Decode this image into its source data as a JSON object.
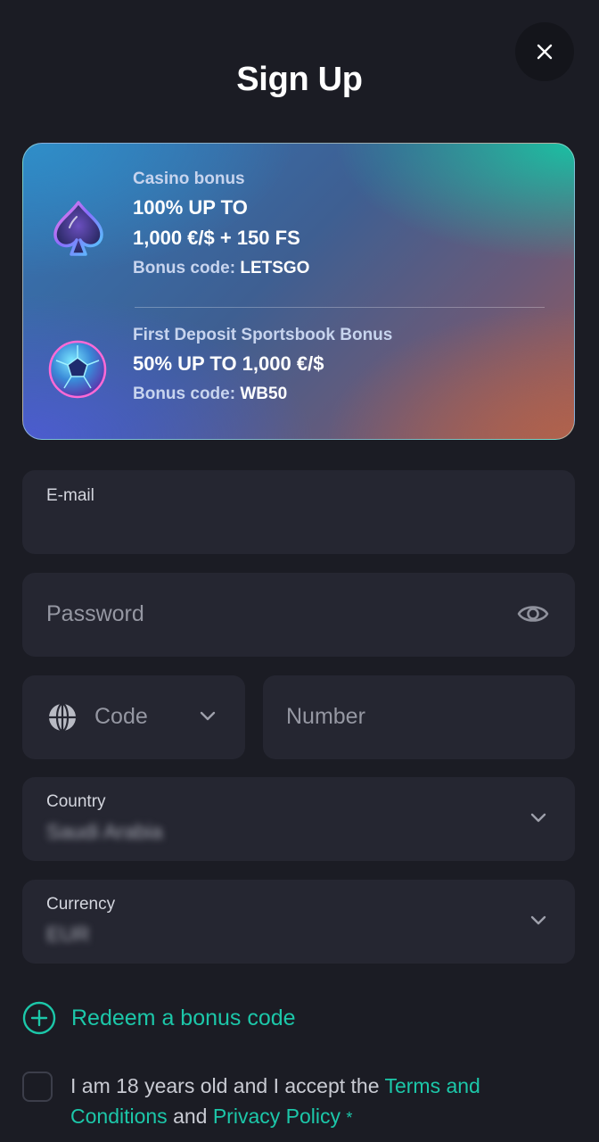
{
  "header": {
    "title": "Sign Up"
  },
  "bonuses": [
    {
      "kicker": "Casino bonus",
      "line1": "100% UP TO",
      "line2": "1,000 €/$ + 150 FS",
      "code_label": "Bonus code:",
      "code": "LETSGO",
      "icon": "spade-icon"
    },
    {
      "kicker": "First Deposit Sportsbook Bonus",
      "line1": "50% UP TO 1,000 €/$",
      "code_label": "Bonus code:",
      "code": "WB50",
      "icon": "soccer-ball-icon"
    }
  ],
  "form": {
    "email_label": "E-mail",
    "password_placeholder": "Password",
    "code_placeholder": "Code",
    "number_placeholder": "Number",
    "country_label": "Country",
    "country_value": "Saudi Arabia",
    "currency_label": "Currency",
    "currency_value": "EUR"
  },
  "redeem_label": "Redeem a bonus code",
  "terms": {
    "prefix": "I am 18 years old and I accept the ",
    "terms_link": "Terms and Conditions",
    "middle": " and ",
    "privacy_link": "Privacy Policy",
    "required_mark": "*"
  },
  "colors": {
    "background": "#1b1c24",
    "field": "#252631",
    "accent": "#1cc7a9"
  }
}
